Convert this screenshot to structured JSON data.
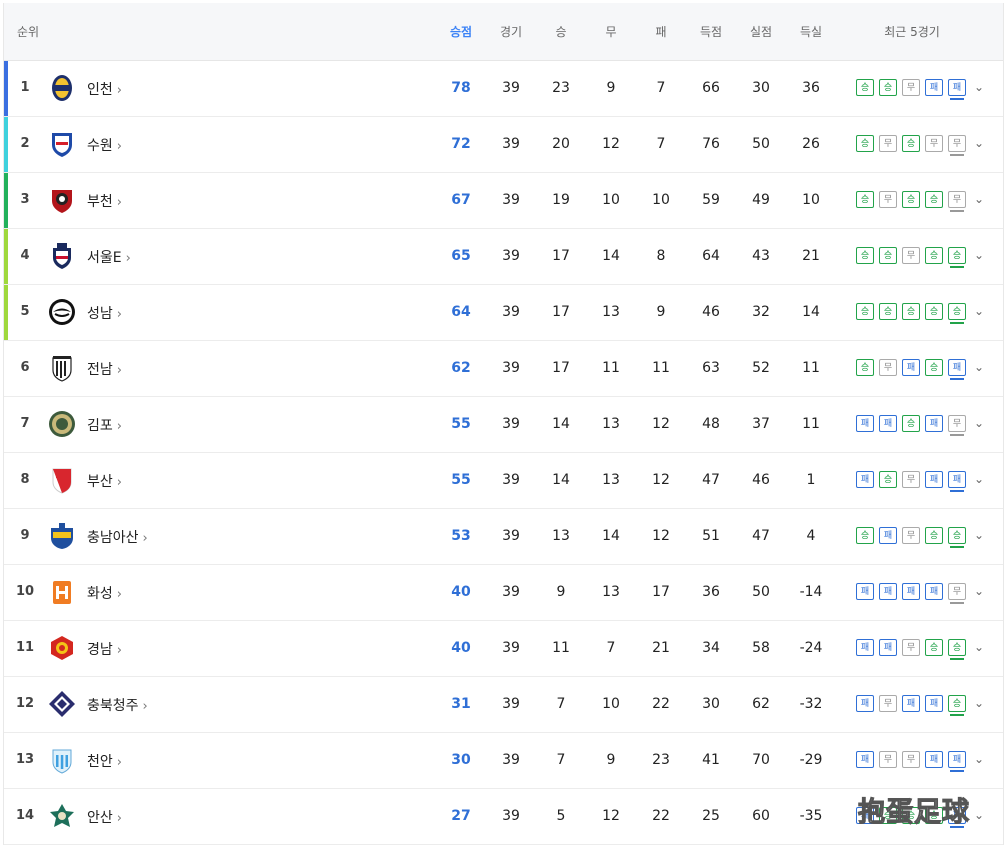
{
  "header": {
    "rank": "순위",
    "points": "승점",
    "played": "경기",
    "wins": "승",
    "draws": "무",
    "losses": "패",
    "goals_for": "득점",
    "goals_against": "실점",
    "goal_diff": "득실",
    "recent": "최근 5경기"
  },
  "form_labels": {
    "W": "승",
    "D": "무",
    "L": "패"
  },
  "colors": {
    "points": "#2f6fd6",
    "win": "#22a34a",
    "draw": "#888888",
    "loss": "#2f6fd6",
    "bar_rank1": "#3b6fe0",
    "bar_rank2": "#3fd1dd",
    "bar_rank3": "#22b15b",
    "bar_rank4_5": "#9fd83d"
  },
  "rows": [
    {
      "rank": "1",
      "team": "인천",
      "pts": "78",
      "played": "39",
      "w": "23",
      "d": "9",
      "l": "7",
      "gf": "66",
      "ga": "30",
      "gd": "36",
      "form": [
        "W",
        "W",
        "D",
        "L",
        "L"
      ],
      "bar": "#3b6fe0",
      "logo": "incheon-logo"
    },
    {
      "rank": "2",
      "team": "수원",
      "pts": "72",
      "played": "39",
      "w": "20",
      "d": "12",
      "l": "7",
      "gf": "76",
      "ga": "50",
      "gd": "26",
      "form": [
        "W",
        "D",
        "W",
        "D",
        "D"
      ],
      "bar": "#3fd1dd",
      "logo": "suwon-logo"
    },
    {
      "rank": "3",
      "team": "부천",
      "pts": "67",
      "played": "39",
      "w": "19",
      "d": "10",
      "l": "10",
      "gf": "59",
      "ga": "49",
      "gd": "10",
      "form": [
        "W",
        "D",
        "W",
        "W",
        "D"
      ],
      "bar": "#22b15b",
      "logo": "bucheon-logo"
    },
    {
      "rank": "4",
      "team": "서울E",
      "pts": "65",
      "played": "39",
      "w": "17",
      "d": "14",
      "l": "8",
      "gf": "64",
      "ga": "43",
      "gd": "21",
      "form": [
        "W",
        "W",
        "D",
        "W",
        "W"
      ],
      "bar": "#9fd83d",
      "logo": "seoul-e-logo"
    },
    {
      "rank": "5",
      "team": "성남",
      "pts": "64",
      "played": "39",
      "w": "17",
      "d": "13",
      "l": "9",
      "gf": "46",
      "ga": "32",
      "gd": "14",
      "form": [
        "W",
        "W",
        "W",
        "W",
        "W"
      ],
      "bar": "#9fd83d",
      "logo": "seongnam-logo"
    },
    {
      "rank": "6",
      "team": "전남",
      "pts": "62",
      "played": "39",
      "w": "17",
      "d": "11",
      "l": "11",
      "gf": "63",
      "ga": "52",
      "gd": "11",
      "form": [
        "W",
        "D",
        "L",
        "W",
        "L"
      ],
      "bar": "",
      "logo": "jeonnam-logo"
    },
    {
      "rank": "7",
      "team": "김포",
      "pts": "55",
      "played": "39",
      "w": "14",
      "d": "13",
      "l": "12",
      "gf": "48",
      "ga": "37",
      "gd": "11",
      "form": [
        "L",
        "L",
        "W",
        "L",
        "D"
      ],
      "bar": "",
      "logo": "gimpo-logo"
    },
    {
      "rank": "8",
      "team": "부산",
      "pts": "55",
      "played": "39",
      "w": "14",
      "d": "13",
      "l": "12",
      "gf": "47",
      "ga": "46",
      "gd": "1",
      "form": [
        "L",
        "W",
        "D",
        "L",
        "L"
      ],
      "bar": "",
      "logo": "busan-logo"
    },
    {
      "rank": "9",
      "team": "충남아산",
      "pts": "53",
      "played": "39",
      "w": "13",
      "d": "14",
      "l": "12",
      "gf": "51",
      "ga": "47",
      "gd": "4",
      "form": [
        "W",
        "L",
        "D",
        "W",
        "W"
      ],
      "bar": "",
      "logo": "chungnam-asan-logo"
    },
    {
      "rank": "10",
      "team": "화성",
      "pts": "40",
      "played": "39",
      "w": "9",
      "d": "13",
      "l": "17",
      "gf": "36",
      "ga": "50",
      "gd": "-14",
      "form": [
        "L",
        "L",
        "L",
        "L",
        "D"
      ],
      "bar": "",
      "logo": "hwaseong-logo"
    },
    {
      "rank": "11",
      "team": "경남",
      "pts": "40",
      "played": "39",
      "w": "11",
      "d": "7",
      "l": "21",
      "gf": "34",
      "ga": "58",
      "gd": "-24",
      "form": [
        "L",
        "L",
        "D",
        "W",
        "W"
      ],
      "bar": "",
      "logo": "gyeongnam-logo"
    },
    {
      "rank": "12",
      "team": "충북청주",
      "pts": "31",
      "played": "39",
      "w": "7",
      "d": "10",
      "l": "22",
      "gf": "30",
      "ga": "62",
      "gd": "-32",
      "form": [
        "L",
        "D",
        "L",
        "L",
        "W"
      ],
      "bar": "",
      "logo": "chungbuk-cheongju-logo"
    },
    {
      "rank": "13",
      "team": "천안",
      "pts": "30",
      "played": "39",
      "w": "7",
      "d": "9",
      "l": "23",
      "gf": "41",
      "ga": "70",
      "gd": "-29",
      "form": [
        "L",
        "D",
        "D",
        "L",
        "L"
      ],
      "bar": "",
      "logo": "cheonan-logo"
    },
    {
      "rank": "14",
      "team": "안산",
      "pts": "27",
      "played": "39",
      "w": "5",
      "d": "12",
      "l": "22",
      "gf": "25",
      "ga": "60",
      "gd": "-35",
      "form": [
        "L",
        "W",
        "W",
        "W",
        "L"
      ],
      "bar": "",
      "logo": "ansan-logo"
    }
  ],
  "watermark": "抱蛋足球"
}
